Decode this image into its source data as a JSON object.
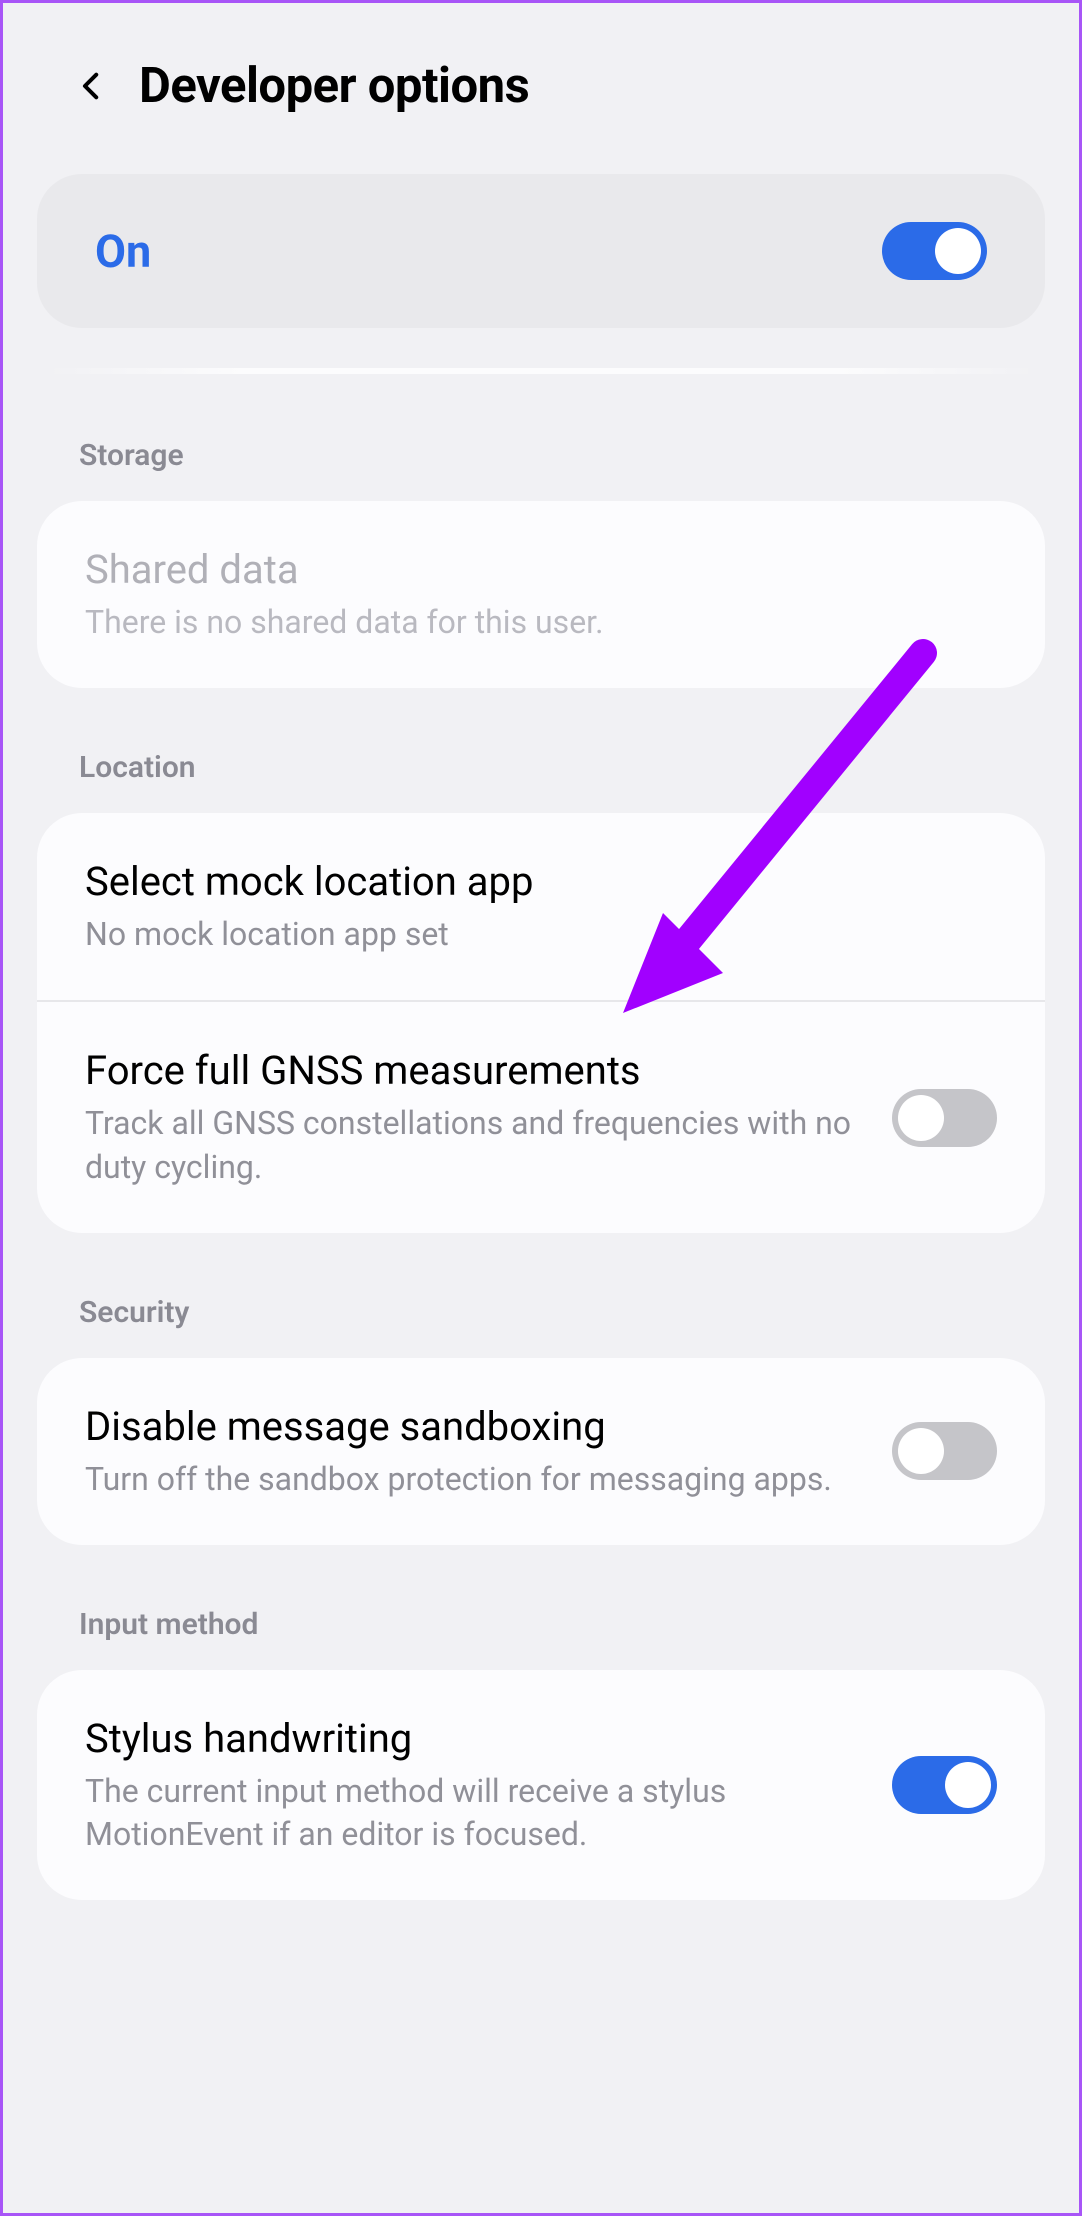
{
  "header": {
    "title": "Developer options"
  },
  "master": {
    "label": "On",
    "enabled": true
  },
  "sections": [
    {
      "title": "Storage",
      "items": [
        {
          "title": "Shared data",
          "subtitle": "There is no shared data for this user.",
          "disabled": true,
          "toggle": null
        }
      ]
    },
    {
      "title": "Location",
      "items": [
        {
          "title": "Select mock location app",
          "subtitle": "No mock location app set",
          "disabled": false,
          "toggle": null
        },
        {
          "title": "Force full GNSS measurements",
          "subtitle": "Track all GNSS constellations and frequencies with no duty cycling.",
          "disabled": false,
          "toggle": false
        }
      ]
    },
    {
      "title": "Security",
      "items": [
        {
          "title": "Disable message sandboxing",
          "subtitle": "Turn off the sandbox protection for messaging apps.",
          "disabled": false,
          "toggle": false
        }
      ]
    },
    {
      "title": "Input method",
      "items": [
        {
          "title": "Stylus handwriting",
          "subtitle": "The current input method will receive a stylus MotionEvent if an editor is focused.",
          "disabled": false,
          "toggle": true
        }
      ]
    }
  ]
}
